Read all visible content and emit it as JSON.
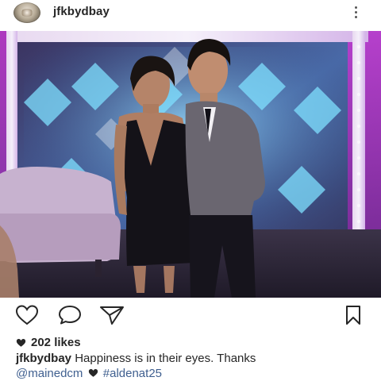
{
  "post": {
    "username": "jfkbydbay"
  },
  "icons": {
    "avatar": "profile-avatar",
    "more": "vertical-ellipsis-icon",
    "like": "heart-outline-icon",
    "comment": "speech-bubble-icon",
    "share": "paper-plane-icon",
    "save": "bookmark-icon",
    "likes_heart": "heart-filled-icon"
  },
  "likes": {
    "count": "202 likes"
  },
  "caption": {
    "username": "jfkbydbay",
    "text": "Happiness is in their eyes.  Thanks",
    "mention": "@mainedcm",
    "hashtag": "#aldenat25"
  },
  "colors": {
    "link": "#3f5f8f",
    "text": "#262626",
    "background": "#ffffff"
  }
}
